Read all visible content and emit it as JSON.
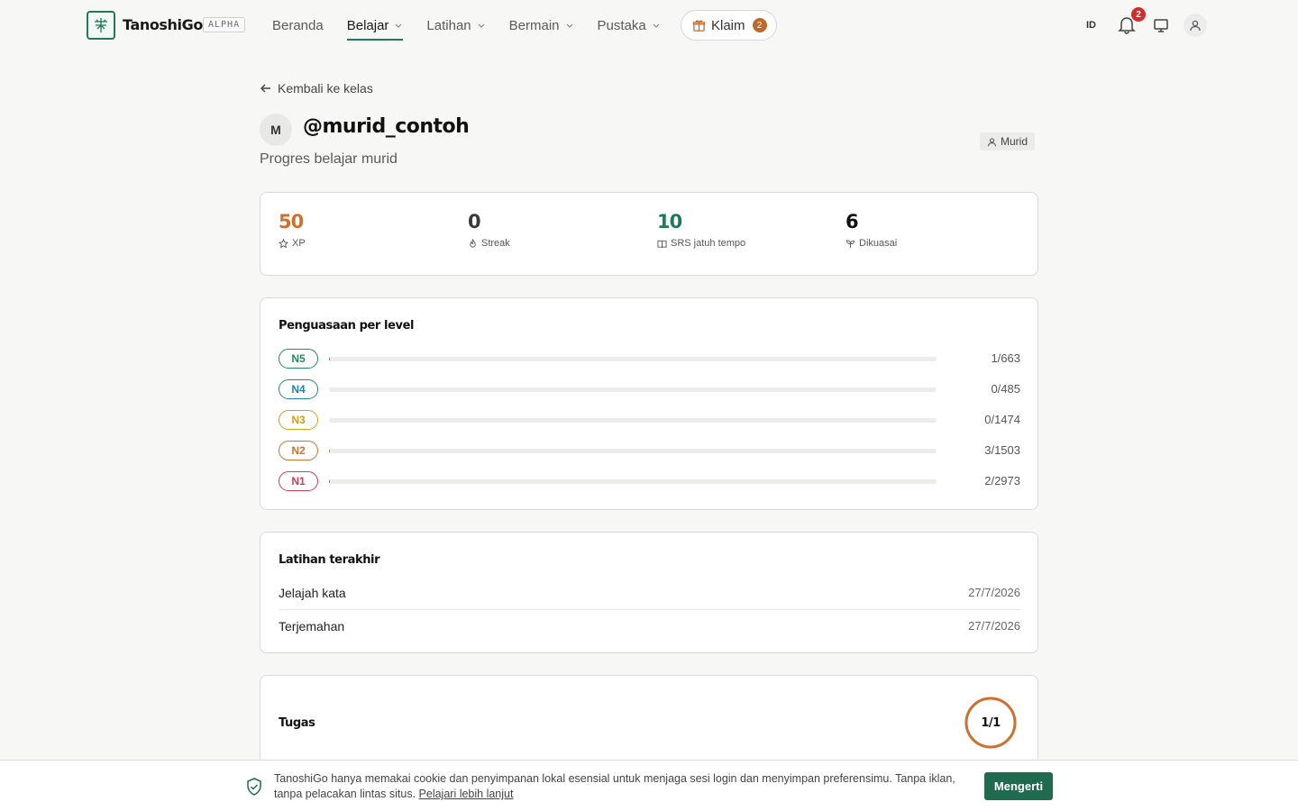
{
  "header": {
    "brand": "TanoshiGo",
    "badge": "ALPHA",
    "nav": [
      {
        "label": "Beranda"
      },
      {
        "label": "Belajar"
      },
      {
        "label": "Latihan"
      },
      {
        "label": "Bermain"
      },
      {
        "label": "Pustaka"
      }
    ],
    "active_nav": "Belajar",
    "claim": {
      "label": "Klaim",
      "count": "2"
    },
    "language": "ID",
    "notification_count": "2",
    "icons": [
      "kanji-logo-icon",
      "chevron-down-icon",
      "gift-icon",
      "bell-icon",
      "monitor-icon",
      "user-icon"
    ]
  },
  "page": {
    "back_label": "Kembali ke kelas",
    "avatar_initial": "M",
    "username": "@murid_contoh",
    "subtitle": "Progres belajar murid",
    "role": "Murid"
  },
  "stats": [
    {
      "value": "50",
      "label": "XP",
      "icon": "star-icon",
      "color": "#d0702e"
    },
    {
      "value": "0",
      "label": "Streak",
      "icon": "flame-icon",
      "color": "#3a3a3a"
    },
    {
      "value": "10",
      "label": "SRS jatuh tempo",
      "icon": "book-icon",
      "color": "#1f7a5c"
    },
    {
      "value": "6",
      "label": "Dikuasai",
      "icon": "sprout-icon",
      "color": "#111111"
    }
  ],
  "mastery": {
    "title": "Penguasaan per level",
    "levels": [
      {
        "level": "N5",
        "count": "1/663",
        "mastered": 1,
        "total": 663,
        "color": "#1f8a5e"
      },
      {
        "level": "N4",
        "count": "0/485",
        "mastered": 0,
        "total": 485,
        "color": "#1f7fb5"
      },
      {
        "level": "N3",
        "count": "0/1474",
        "mastered": 0,
        "total": 1474,
        "color": "#d4a017"
      },
      {
        "level": "N2",
        "count": "3/1503",
        "mastered": 3,
        "total": 1503,
        "color": "#d0702e"
      },
      {
        "level": "N1",
        "count": "2/2973",
        "mastered": 2,
        "total": 2973,
        "color": "#d23a5a"
      }
    ]
  },
  "recent": {
    "title": "Latihan terakhir",
    "items": [
      {
        "name": "Jelajah kata",
        "date": "27/7/2026"
      },
      {
        "name": "Terjemahan",
        "date": "27/7/2026"
      }
    ]
  },
  "tasks": {
    "title": "Tugas",
    "progress_label": "1/1",
    "progress": 1.0,
    "color": "#d0702e"
  },
  "cookie": {
    "text": "TanoshiGo hanya memakai cookie dan penyimpanan lokal esensial untuk menjaga sesi login dan menyimpan preferensimu. Tanpa iklan, tanpa pelacakan lintas situs.",
    "link": "Pelajari lebih lanjut",
    "button": "Mengerti"
  }
}
